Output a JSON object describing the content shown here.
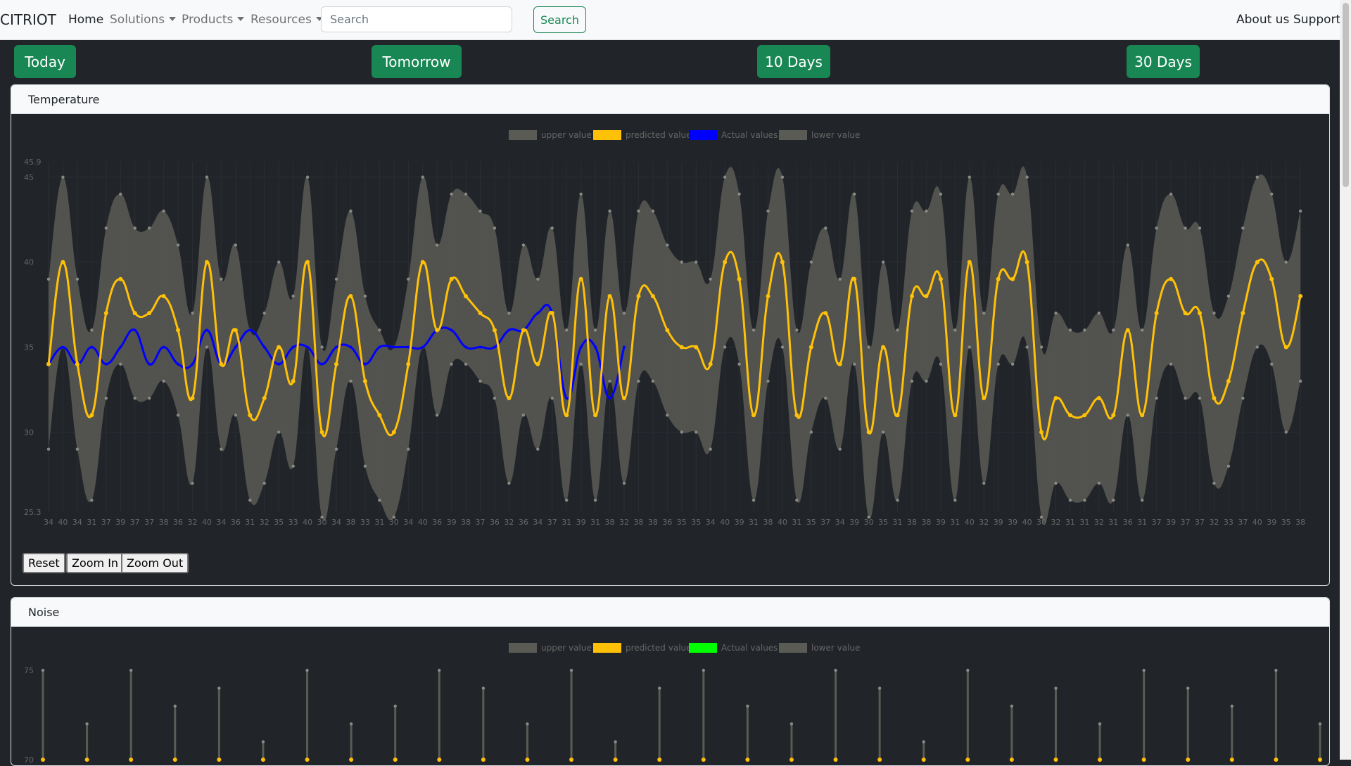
{
  "navbar": {
    "brand": "CITRIOT",
    "links": {
      "home": "Home",
      "solutions": "Solutions",
      "products": "Products",
      "resources": "Resources"
    },
    "search": {
      "placeholder": "Search",
      "value": "",
      "button": "Search"
    },
    "right": {
      "about": "About us",
      "support": "Support"
    }
  },
  "ranges": {
    "today": "Today",
    "tomorrow": "Tomorrow",
    "ten_days": "10 Days",
    "thirty_days": "30 Days"
  },
  "colors": {
    "accent": "#198754",
    "predicted": "#ffc107",
    "band": "#5b5b55",
    "temp_actual": "#0000ff",
    "noise_actual": "#00ff00"
  },
  "temperature": {
    "title": "Temperature",
    "controls": {
      "reset": "Reset",
      "zoom_in": "Zoom In",
      "zoom_out": "Zoom Out"
    },
    "chart_data": {
      "type": "line",
      "legend": [
        "upper value",
        "predicted value",
        "Actual values",
        "lower value"
      ],
      "legend_position": "top",
      "y_axis": {
        "min": 25.3,
        "max": 45.9,
        "ticks": [
          "25.3",
          "30",
          "35",
          "40",
          "45",
          "45.9"
        ]
      },
      "x_tick_labels": [
        "34",
        "40",
        "34",
        "31",
        "37",
        "39",
        "37",
        "37",
        "38",
        "36",
        "32",
        "40",
        "34",
        "36",
        "31",
        "32",
        "35",
        "33",
        "40",
        "30",
        "34",
        "38",
        "33",
        "31",
        "30",
        "34",
        "40",
        "36",
        "39",
        "38",
        "37",
        "36",
        "32",
        "36",
        "34",
        "37",
        "31",
        "39",
        "31",
        "38",
        "32",
        "38",
        "38",
        "36",
        "35",
        "35",
        "34",
        "40",
        "39",
        "31",
        "38",
        "40",
        "31",
        "35",
        "37",
        "34",
        "39",
        "30",
        "35",
        "31",
        "38",
        "38",
        "39",
        "31",
        "40",
        "32",
        "39",
        "39",
        "40",
        "30",
        "32",
        "31",
        "31",
        "32",
        "31",
        "36",
        "31",
        "37",
        "39",
        "37",
        "37",
        "32",
        "33",
        "37",
        "40",
        "39",
        "35",
        "38"
      ],
      "series": [
        {
          "name": "predicted value",
          "values": [
            34,
            40,
            34,
            31,
            37,
            39,
            37,
            37,
            38,
            36,
            32,
            40,
            34,
            36,
            31,
            32,
            35,
            33,
            40,
            30,
            34,
            38,
            33,
            31,
            30,
            34,
            40,
            36,
            39,
            38,
            37,
            36,
            32,
            36,
            34,
            37,
            31,
            39,
            31,
            38,
            32,
            38,
            38,
            36,
            35,
            35,
            34,
            40,
            39,
            31,
            38,
            40,
            31,
            35,
            37,
            34,
            39,
            30,
            35,
            31,
            38,
            38,
            39,
            31,
            40,
            32,
            39,
            39,
            40,
            30,
            32,
            31,
            31,
            32,
            31,
            36,
            31,
            37,
            39,
            37,
            37,
            32,
            33,
            37,
            40,
            39,
            35,
            38
          ]
        },
        {
          "name": "Actual values",
          "values": [
            34,
            35,
            34,
            35,
            34,
            35,
            36,
            34,
            35,
            34,
            34,
            36,
            34,
            35,
            36,
            35,
            34,
            35,
            35,
            34,
            35,
            35,
            34,
            35,
            35,
            35,
            35,
            36,
            36,
            35,
            35,
            35,
            36,
            36,
            37,
            37,
            32,
            35,
            35,
            32,
            35
          ]
        },
        {
          "name": "upper value",
          "values": [
            39,
            45,
            39,
            36,
            42,
            44,
            42,
            42,
            43,
            41,
            37,
            45,
            39,
            41,
            36,
            37,
            40,
            38,
            45,
            35,
            39,
            43,
            38,
            36,
            35,
            39,
            45,
            41,
            44,
            44,
            43,
            42,
            37,
            41,
            39,
            42,
            36,
            44,
            36,
            43,
            37,
            43,
            43,
            41,
            40,
            40,
            39,
            45,
            44,
            36,
            43,
            45,
            36,
            40,
            42,
            39,
            44,
            35,
            40,
            36,
            43,
            43,
            44,
            36,
            45,
            37,
            44,
            44,
            45,
            35,
            37,
            36,
            36,
            37,
            36,
            41,
            36,
            42,
            44,
            42,
            42,
            37,
            38,
            42,
            45,
            44,
            40,
            43
          ]
        },
        {
          "name": "lower value",
          "values": [
            29,
            35,
            29,
            26,
            32,
            34,
            32,
            32,
            33,
            31,
            27,
            35,
            29,
            31,
            26,
            27,
            30,
            28,
            35,
            25,
            29,
            33,
            28,
            26,
            25,
            29,
            35,
            31,
            34,
            34,
            33,
            32,
            27,
            31,
            29,
            32,
            26,
            34,
            26,
            33,
            27,
            33,
            33,
            31,
            30,
            30,
            29,
            35,
            34,
            26,
            33,
            35,
            26,
            30,
            32,
            29,
            34,
            25,
            30,
            26,
            33,
            33,
            34,
            26,
            35,
            27,
            34,
            34,
            35,
            25,
            27,
            26,
            26,
            27,
            26,
            31,
            26,
            32,
            34,
            32,
            32,
            27,
            28,
            32,
            35,
            34,
            30,
            33
          ]
        }
      ]
    }
  },
  "noise": {
    "title": "Noise",
    "chart_data": {
      "type": "line",
      "legend": [
        "upper value",
        "predicted value",
        "Actual values",
        "lower value"
      ],
      "legend_position": "top",
      "y_axis": {
        "ticks": [
          "75",
          "70"
        ]
      },
      "series": [
        {
          "name": "predicted value",
          "values": [
            70,
            70,
            70,
            70,
            70,
            70,
            70,
            70,
            70,
            70,
            70,
            70,
            70,
            70,
            70,
            70,
            70,
            70,
            70,
            70,
            70,
            70,
            70,
            70,
            70,
            70,
            70,
            70,
            70,
            70
          ]
        },
        {
          "name": "upper value",
          "values": [
            75,
            72,
            75,
            73,
            74,
            71,
            75,
            72,
            73,
            75,
            74,
            72,
            75,
            71,
            74,
            75,
            73,
            72,
            75,
            74,
            71,
            75,
            73,
            74,
            72,
            75,
            74,
            73,
            75,
            72
          ]
        }
      ]
    }
  }
}
